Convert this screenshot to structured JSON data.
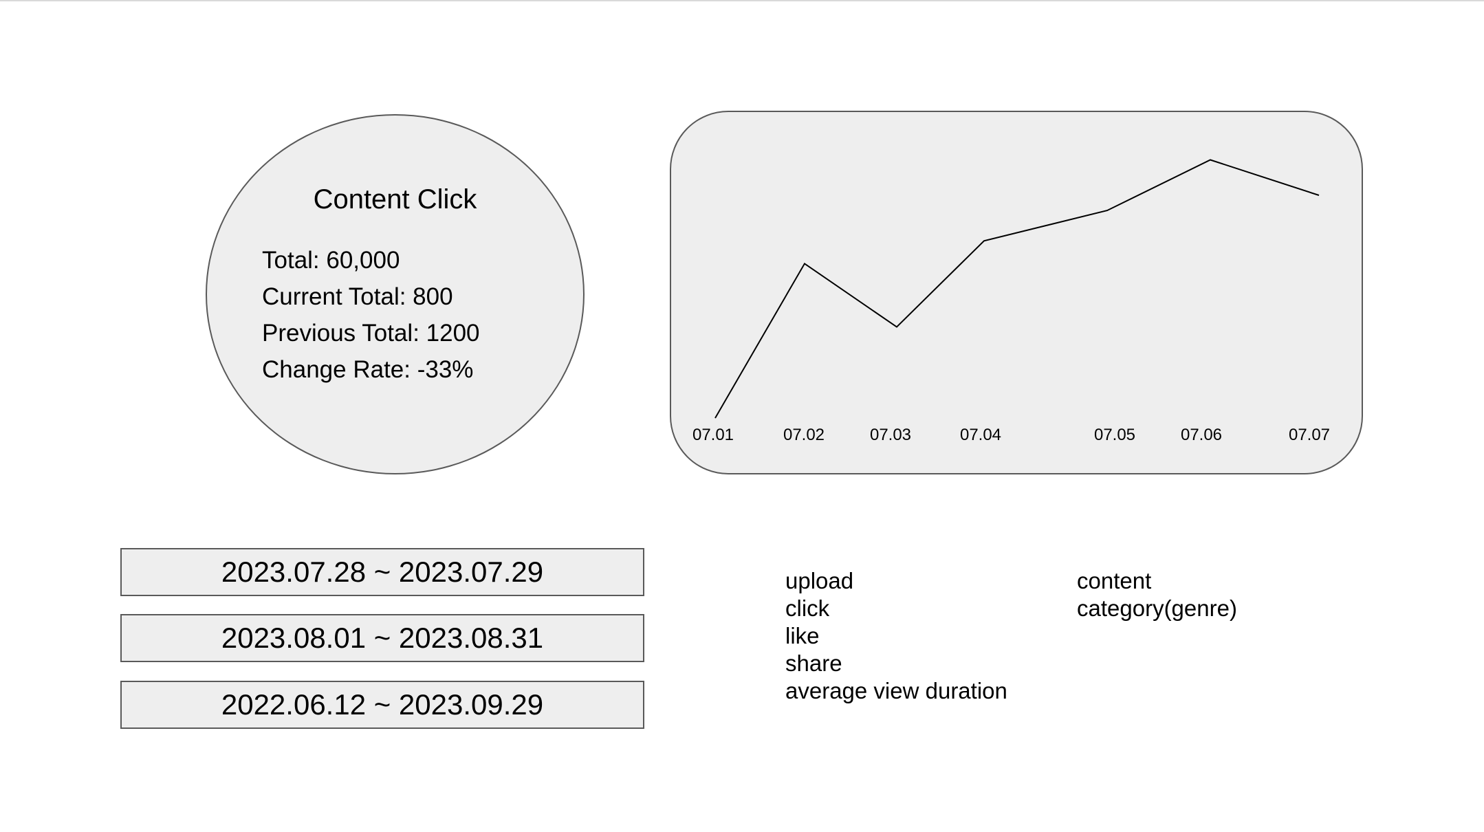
{
  "summary_card": {
    "title": "Content Click",
    "lines": [
      "Total: 60,000",
      "Current Total: 800",
      "Previous Total: 1200",
      "Change Rate: -33%"
    ]
  },
  "chart_data": {
    "type": "line",
    "categories": [
      "07.01",
      "07.02",
      "07.03",
      "07.04",
      "07.05",
      "07.06",
      "07.07"
    ],
    "series": [
      {
        "values": [
          0,
          6.1,
          3.6,
          7.0,
          8.2,
          10.2,
          8.8
        ]
      }
    ],
    "ylim": [
      0,
      11
    ],
    "grid": false
  },
  "date_ranges": [
    {
      "label": "2023.07.28 ~ 2023.07.29"
    },
    {
      "label": "2023.08.01 ~ 2023.08.31"
    },
    {
      "label": "2022.06.12 ~ 2023.09.29"
    }
  ],
  "metrics": {
    "items": [
      {
        "label": "upload"
      },
      {
        "label": "click"
      },
      {
        "label": "like"
      },
      {
        "label": "share"
      },
      {
        "label": "average view duration"
      }
    ]
  },
  "dimensions": {
    "items": [
      {
        "label": "content"
      },
      {
        "label": "category(genre)"
      }
    ]
  },
  "colors": {
    "panel_fill": "#eeeeee",
    "panel_border": "#595959",
    "line": "#000000"
  }
}
